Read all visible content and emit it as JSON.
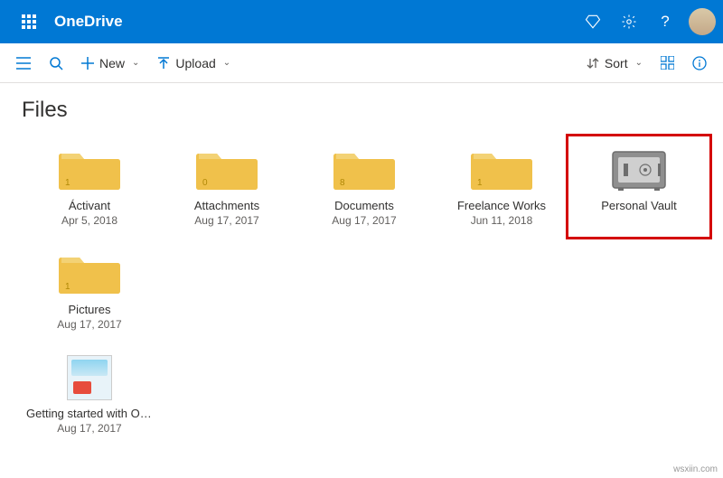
{
  "header": {
    "brand": "OneDrive"
  },
  "commandBar": {
    "newLabel": "New",
    "uploadLabel": "Upload",
    "sortLabel": "Sort"
  },
  "page": {
    "title": "Files"
  },
  "items": [
    {
      "type": "folder",
      "name": "Áctivant",
      "date": "Apr 5, 2018",
      "count": "1"
    },
    {
      "type": "folder",
      "name": "Attachments",
      "date": "Aug 17, 2017",
      "count": "0"
    },
    {
      "type": "folder",
      "name": "Documents",
      "date": "Aug 17, 2017",
      "count": "8"
    },
    {
      "type": "folder",
      "name": "Freelance Works",
      "date": "Jun 11, 2018",
      "count": "1"
    },
    {
      "type": "vault",
      "name": "Personal Vault",
      "date": ""
    },
    {
      "type": "folder",
      "name": "Pictures",
      "date": "Aug 17, 2017",
      "count": "1"
    },
    {
      "type": "file",
      "name": "Getting started with OneD...",
      "date": "Aug 17, 2017"
    }
  ],
  "highlight": {
    "row": 0,
    "col": 4
  },
  "watermark": "wsxiin.com"
}
